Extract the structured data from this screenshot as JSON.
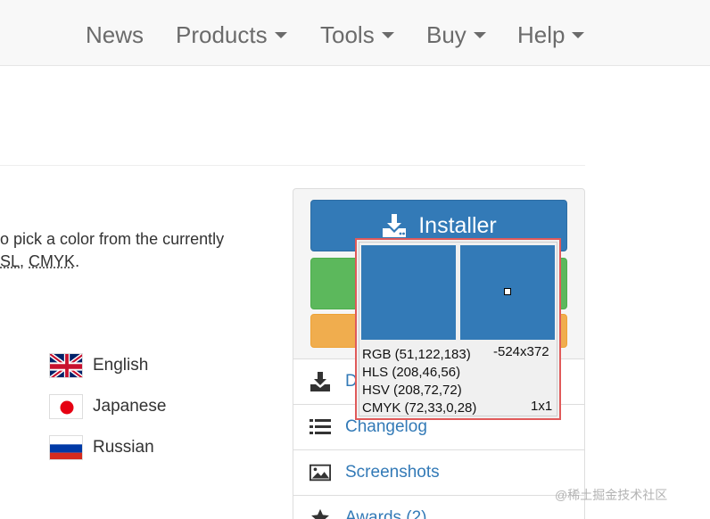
{
  "nav": {
    "items": [
      {
        "label": "News",
        "has_dropdown": false
      },
      {
        "label": "Products",
        "has_dropdown": true
      },
      {
        "label": "Tools",
        "has_dropdown": true
      },
      {
        "label": "Buy",
        "has_dropdown": true
      },
      {
        "label": "Help",
        "has_dropdown": true
      }
    ]
  },
  "description": {
    "line1": "o pick a color from the currently",
    "line2_abbr1": "SL",
    "line2_sep": ", ",
    "line2_abbr2": "CMYK",
    "line2_end": "."
  },
  "languages": [
    {
      "label": "English",
      "flag": "uk-flag-icon"
    },
    {
      "label": "Japanese",
      "flag": "japan-flag-icon"
    },
    {
      "label": "Russian",
      "flag": "russia-flag-icon"
    }
  ],
  "download_panel": {
    "installer_label": "Installer",
    "list": [
      {
        "label": "D",
        "icon": "download-icon"
      },
      {
        "label": "Changelog",
        "icon": "list-icon"
      },
      {
        "label": "Screenshots",
        "icon": "image-icon"
      },
      {
        "label": "Awards (2)",
        "icon": "star-icon"
      }
    ]
  },
  "color_picker": {
    "rgb": "RGB (51,122,183)",
    "hls": "HLS (208,46,56)",
    "hsv": "HSV (208,72,72)",
    "cmyk": "CMYK (72,33,0,28)",
    "position": "-524x372",
    "zoom": "1x1",
    "sample_color": "#337ab7"
  },
  "watermark": "@稀土掘金技术社区",
  "colors": {
    "primary": "#337ab7",
    "success": "#5cb85c",
    "warning": "#f0ad4e",
    "picker_border": "#e05a5a"
  }
}
